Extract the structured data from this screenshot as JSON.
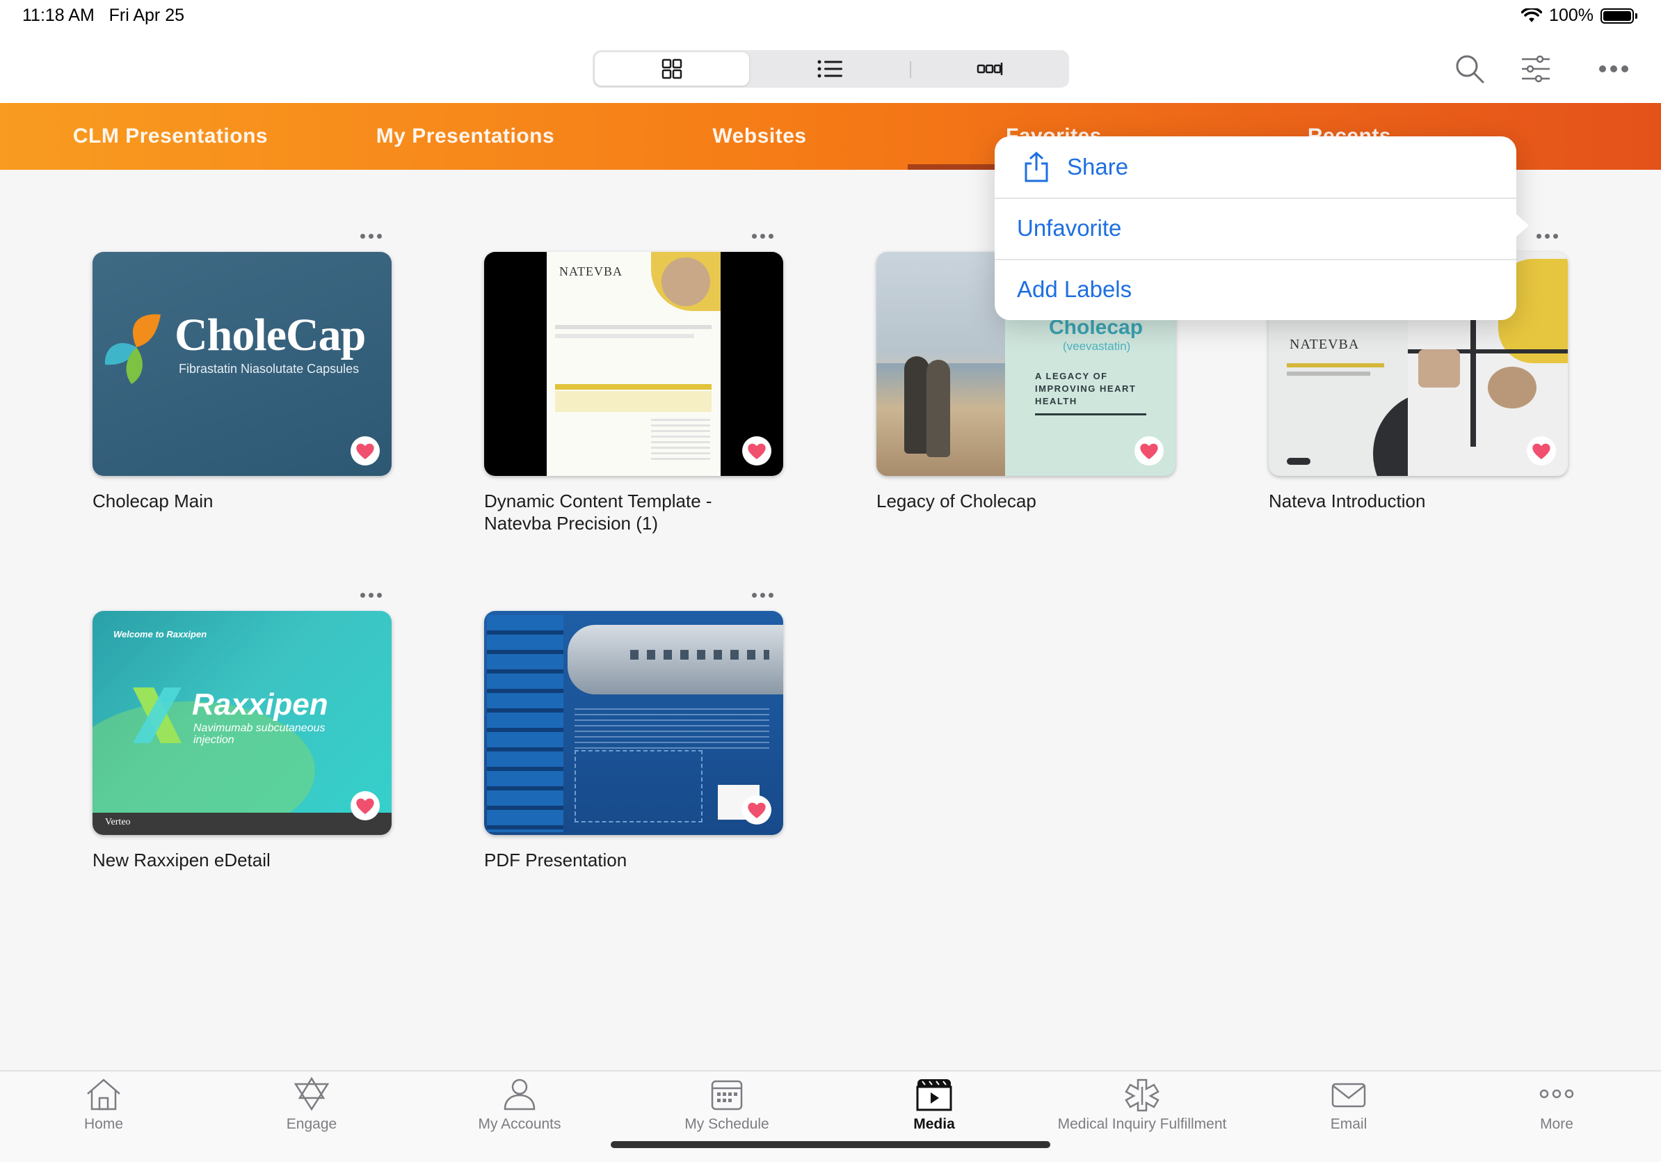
{
  "status": {
    "time": "11:18 AM",
    "date": "Fri Apr 25",
    "battery": "100%"
  },
  "toolbar": {
    "view_grid": "grid-view",
    "view_list": "list-view",
    "view_carousel": "carousel-view"
  },
  "tabs": [
    {
      "label": "CLM Presentations"
    },
    {
      "label": "My Presentations"
    },
    {
      "label": "Websites"
    },
    {
      "label": "Favorites"
    },
    {
      "label": "Recents"
    }
  ],
  "menu": {
    "share": "Share",
    "unfavorite": "Unfavorite",
    "add_labels": "Add Labels"
  },
  "cards": [
    {
      "title": "Cholecap Main",
      "thumb_brand": "CholeCap",
      "thumb_sub": "Fibrastatin Niasolutate Capsules",
      "favorite": true
    },
    {
      "title": "Dynamic Content Template - Natevba Precision (1)",
      "thumb_brand": "NATEVBA",
      "favorite": true
    },
    {
      "title": "Legacy of Cholecap",
      "thumb_brand": "Cholecap",
      "thumb_sub": "(veevastatin)",
      "thumb_tagline": "A LEGACY OF IMPROVING HEART HEALTH",
      "favorite": true
    },
    {
      "title": "Nateva Introduction",
      "thumb_brand": "NATEVBA",
      "favorite": true
    },
    {
      "title": "New Raxxipen eDetail",
      "thumb_brand": "Raxxipen",
      "thumb_sub": "Navimumab subcutaneous injection",
      "thumb_welcome": "Welcome to Raxxipen",
      "thumb_footer": "Verteo",
      "favorite": true
    },
    {
      "title": "PDF Presentation",
      "favorite": true
    }
  ],
  "nav": [
    {
      "label": "Home"
    },
    {
      "label": "Engage"
    },
    {
      "label": "My Accounts"
    },
    {
      "label": "My Schedule"
    },
    {
      "label": "Media",
      "active": true
    },
    {
      "label": "Medical Inquiry Fulfillment"
    },
    {
      "label": "Email"
    },
    {
      "label": "More"
    }
  ],
  "colors": {
    "accent": "#1d6fe0",
    "tab_start": "#f99b20",
    "tab_end": "#e4521a",
    "heart": "#f0506e"
  }
}
